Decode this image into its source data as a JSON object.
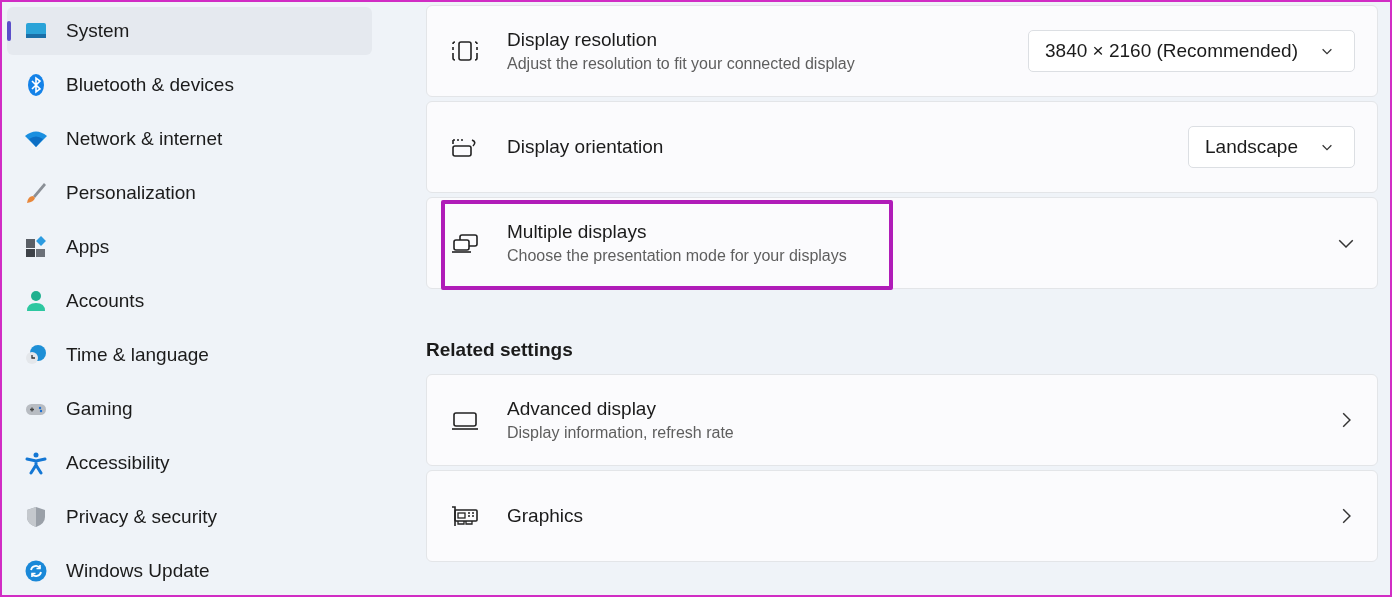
{
  "sidebar": {
    "items": [
      {
        "label": "System",
        "selected": true
      },
      {
        "label": "Bluetooth & devices",
        "selected": false
      },
      {
        "label": "Network & internet",
        "selected": false
      },
      {
        "label": "Personalization",
        "selected": false
      },
      {
        "label": "Apps",
        "selected": false
      },
      {
        "label": "Accounts",
        "selected": false
      },
      {
        "label": "Time & language",
        "selected": false
      },
      {
        "label": "Gaming",
        "selected": false
      },
      {
        "label": "Accessibility",
        "selected": false
      },
      {
        "label": "Privacy & security",
        "selected": false
      },
      {
        "label": "Windows Update",
        "selected": false
      }
    ]
  },
  "display_rows": [
    {
      "kind": "dropdown",
      "title": "Display resolution",
      "subtitle": "Adjust the resolution to fit your connected display",
      "value": "3840 × 2160 (Recommended)",
      "highlighted": false
    },
    {
      "kind": "dropdown",
      "title": "Display orientation",
      "value": "Landscape",
      "highlighted": false
    },
    {
      "kind": "expander",
      "title": "Multiple displays",
      "subtitle": "Choose the presentation mode for your displays",
      "highlighted": true
    }
  ],
  "related_settings": {
    "heading": "Related settings",
    "rows": [
      {
        "kind": "link",
        "title": "Advanced display",
        "subtitle": "Display information, refresh rate",
        "highlighted": false
      },
      {
        "kind": "link",
        "title": "Graphics",
        "highlighted": false
      }
    ]
  }
}
